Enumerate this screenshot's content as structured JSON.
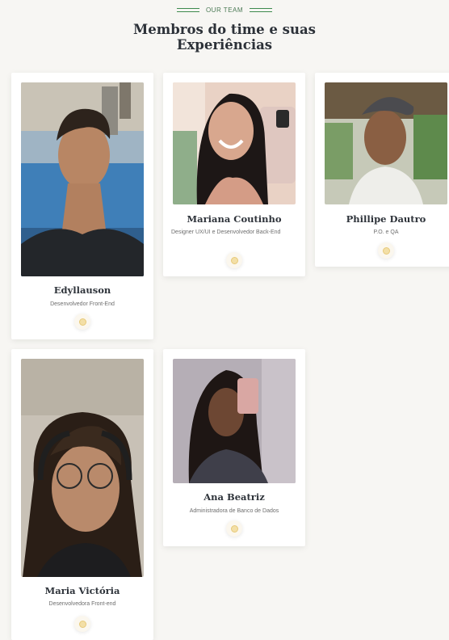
{
  "section": {
    "eyebrow": "OUR TEAM",
    "title_line1": "Membros do time e suas",
    "title_line2": "Experiências"
  },
  "members": [
    {
      "name": "Edyllauson",
      "role": "Desenvolvedor Front-End",
      "icon": "social-icon"
    },
    {
      "name": "Mariana Coutinho",
      "role": "Designer UX/UI e Desenvolvedor Back-End",
      "icon": "social-icon"
    },
    {
      "name": "Phillipe Dautro",
      "role": "P.O. e QA",
      "icon": "social-icon"
    },
    {
      "name": "Maria Victória",
      "role": "Desenvolvedora Front-end",
      "icon": "social-icon"
    },
    {
      "name": "Ana Beatriz",
      "role": "Administradora de Banco de Dados",
      "icon": "social-icon"
    }
  ],
  "colors": {
    "accent": "#3e8a4e",
    "background": "#f7f6f3",
    "card": "#ffffff",
    "title": "#2c3138"
  }
}
